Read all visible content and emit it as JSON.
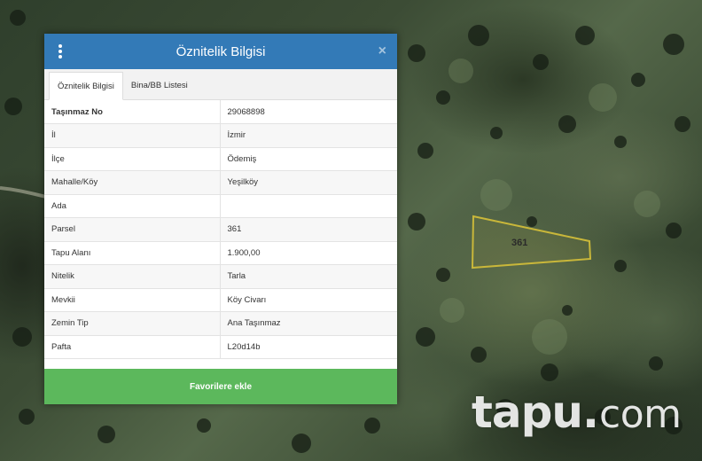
{
  "dialog": {
    "title": "Öznitelik Bilgisi",
    "close_label": "×",
    "tabs": [
      {
        "label": "Öznitelik Bilgisi"
      },
      {
        "label": "Bina/BB Listesi"
      }
    ],
    "rows": [
      {
        "key": "Taşınmaz No",
        "value": "29068898"
      },
      {
        "key": "İl",
        "value": "İzmir"
      },
      {
        "key": "İlçe",
        "value": "Ödemiş"
      },
      {
        "key": "Mahalle/Köy",
        "value": "Yeşilköy"
      },
      {
        "key": "Ada",
        "value": ""
      },
      {
        "key": "Parsel",
        "value": "361"
      },
      {
        "key": "Tapu Alanı",
        "value": "1.900,00"
      },
      {
        "key": "Nitelik",
        "value": "Tarla"
      },
      {
        "key": "Mevkii",
        "value": "Köy Civarı"
      },
      {
        "key": "Zemin Tip",
        "value": "Ana Taşınmaz"
      },
      {
        "key": "Pafta",
        "value": "L20d14b"
      }
    ],
    "favorite_button": "Favorilere ekle"
  },
  "map": {
    "parcel_label": "361",
    "watermark_main": "tapu",
    "watermark_dot": ".",
    "watermark_tld": "com"
  },
  "colors": {
    "header": "#337ab7",
    "button": "#5cb85c",
    "parcel_outline": "#c9b73a"
  }
}
